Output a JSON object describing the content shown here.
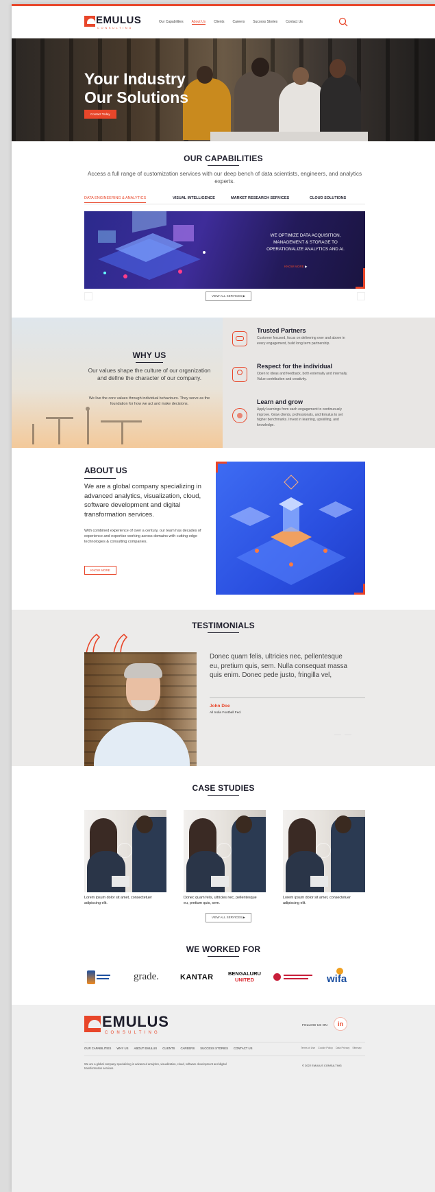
{
  "brand": {
    "name": "EMULUS",
    "sub": "CONSULTING",
    "accent": "#e8462a",
    "dark": "#1d1d2b"
  },
  "nav": {
    "items": [
      "Our Capabilities",
      "About Us",
      "Clients",
      "Careers",
      "Success Stories",
      "Contact Us"
    ],
    "active_index": 1,
    "icon": "search-icon"
  },
  "hero": {
    "line1": "Your Industry",
    "line2": "Our Solutions",
    "cta": "Contact Today"
  },
  "capabilities": {
    "title": "OUR CAPABILITIES",
    "intro": "Access a full range of customization services with our deep bench of data scientists, engineers, and analytics experts.",
    "tabs": [
      "DATA ENGINEERING & ANALYTICS",
      "VISUAL INTELLIGENCE",
      "MARKET RESEARCH SERVICES",
      "CLOUD SOLUTIONS"
    ],
    "active_tab": 0,
    "banner_text": "WE OPTIMIZE DATA ACQUISITION, MANAGEMENT & STORAGE TO OPERATIONALIZE ANALYTICS AND AI.",
    "banner_link": "KNOW MORE",
    "view_all": "VIEW ALL SERVICES"
  },
  "why": {
    "title": "WHY US",
    "lead": "Our values shape the culture of our organization and define the character of our company.",
    "body": "We live the core values through individual behaviours. They serve as the foundation for how we act and make decisions.",
    "values": [
      {
        "title": "Trusted Partners",
        "text": "Customer focused, focus on delivering over and above in every engagement, build long term partnership.",
        "icon": "handshake-icon"
      },
      {
        "title": "Respect for the individual",
        "text": "Open to ideas and feedback, both externally and internally. Value contribution and creativity.",
        "icon": "people-icon"
      },
      {
        "title": "Learn and grow",
        "text": "Apply learnings from each engagement to continuously improve. Grow clients, professionals, and Emulus to set higher benchmarks. Invest in learning, upskilling, and knowledge.",
        "icon": "brain-icon"
      }
    ]
  },
  "about": {
    "title": "ABOUT US",
    "lead": "We are a global company specializing in advanced analytics, visualization, cloud, software development and digital transformation services.",
    "body": "With combined experience of over a century, our team has decades of experience and expertise working across domains with cutting-edge technologies & consulting companies.",
    "cta": "KNOW MORE"
  },
  "testimonials": {
    "title": "TESTIMONIALS",
    "quote": "Donec quam felis, ultricies nec, pellentesque eu, pretium quis, sem. Nulla consequat massa quis enim. Donec pede justo, fringilla vel,",
    "name": "John Doe",
    "role": "All India Football Fed."
  },
  "cases": {
    "title": "CASE STUDIES",
    "items": [
      {
        "caption": "Lorem ipsum dolor sit amet, consectetuer adipiscing elit."
      },
      {
        "caption": "Donec quam felis, ultricies nec, pellentesque eu, pretium quis, sem."
      },
      {
        "caption": "Lorem ipsum dolor sit amet, consectetuer adipiscing elit."
      }
    ],
    "view_all": "VIEW ALL SERVICES"
  },
  "clients": {
    "title": "WE WORKED FOR",
    "logos": [
      "grade.",
      "KANTAR",
      "BENGALURU",
      "UNITED",
      "wifa"
    ]
  },
  "footer": {
    "follow": "FOLLOW US ON",
    "links": [
      "OUR CAPABILITIES",
      "WHY US",
      "ABOUT EMULUS",
      "CLIENTS",
      "CAREERS",
      "SUCCESS STORIES",
      "CONTACT US"
    ],
    "legal": [
      "Terms of Use",
      "Cookie Policy",
      "Data Privacy",
      "Sitemap"
    ],
    "blurb": "We are a global company specializing in advanced analytics, visualization, cloud, software development and digital transformation services.",
    "copyright": "© 2022 EMULUS CONSULTING"
  }
}
